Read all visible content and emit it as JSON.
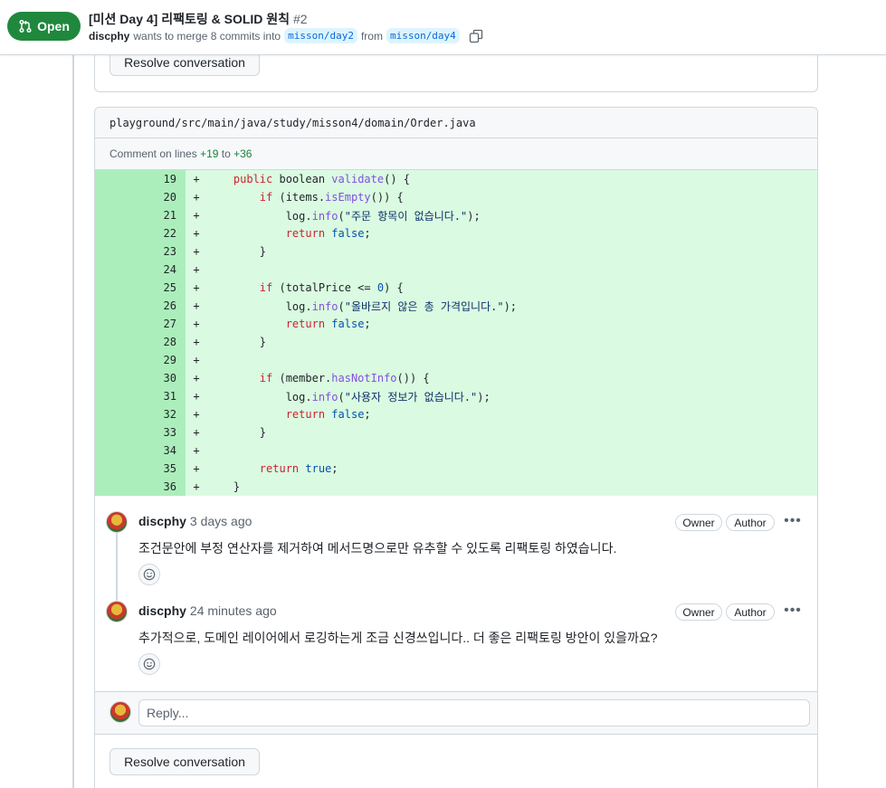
{
  "header": {
    "state_label": "Open",
    "title": "[미션 Day 4] 리팩토링 & SOLID 원칙",
    "number": "#2",
    "author": "discphy",
    "merge_text": "wants to merge 8 commits into",
    "base_branch": "misson/day2",
    "from_text": "from",
    "head_branch": "misson/day4"
  },
  "top_box": {
    "resolve_label": "Resolve conversation"
  },
  "thread": {
    "file_path": "playground/src/main/java/study/misson4/domain/Order.java",
    "comment_on_prefix": "Comment on lines",
    "line_start": "+19",
    "to_text": "to",
    "line_end": "+36",
    "diff": [
      {
        "n": "19",
        "m": "+",
        "tokens": [
          {
            "t": "    "
          },
          {
            "t": "public",
            "c": "kw"
          },
          {
            "t": " boolean "
          },
          {
            "t": "validate",
            "c": "fn"
          },
          {
            "t": "() {"
          }
        ]
      },
      {
        "n": "20",
        "m": "+",
        "tokens": [
          {
            "t": "        "
          },
          {
            "t": "if",
            "c": "kw"
          },
          {
            "t": " (items."
          },
          {
            "t": "isEmpty",
            "c": "fn"
          },
          {
            "t": "()) {"
          }
        ]
      },
      {
        "n": "21",
        "m": "+",
        "tokens": [
          {
            "t": "            log."
          },
          {
            "t": "info",
            "c": "fn"
          },
          {
            "t": "("
          },
          {
            "t": "\"주문 항목이 없습니다.\"",
            "c": "str"
          },
          {
            "t": ");"
          }
        ]
      },
      {
        "n": "22",
        "m": "+",
        "tokens": [
          {
            "t": "            "
          },
          {
            "t": "return",
            "c": "kw"
          },
          {
            "t": " "
          },
          {
            "t": "false",
            "c": "num"
          },
          {
            "t": ";"
          }
        ]
      },
      {
        "n": "23",
        "m": "+",
        "tokens": [
          {
            "t": "        }"
          }
        ]
      },
      {
        "n": "24",
        "m": "+",
        "tokens": [
          {
            "t": ""
          }
        ]
      },
      {
        "n": "25",
        "m": "+",
        "tokens": [
          {
            "t": "        "
          },
          {
            "t": "if",
            "c": "kw"
          },
          {
            "t": " (totalPrice <= "
          },
          {
            "t": "0",
            "c": "num"
          },
          {
            "t": ") {"
          }
        ]
      },
      {
        "n": "26",
        "m": "+",
        "tokens": [
          {
            "t": "            log."
          },
          {
            "t": "info",
            "c": "fn"
          },
          {
            "t": "("
          },
          {
            "t": "\"올바르지 않은 총 가격입니다.\"",
            "c": "str"
          },
          {
            "t": ");"
          }
        ]
      },
      {
        "n": "27",
        "m": "+",
        "tokens": [
          {
            "t": "            "
          },
          {
            "t": "return",
            "c": "kw"
          },
          {
            "t": " "
          },
          {
            "t": "false",
            "c": "num"
          },
          {
            "t": ";"
          }
        ]
      },
      {
        "n": "28",
        "m": "+",
        "tokens": [
          {
            "t": "        }"
          }
        ]
      },
      {
        "n": "29",
        "m": "+",
        "tokens": [
          {
            "t": ""
          }
        ]
      },
      {
        "n": "30",
        "m": "+",
        "tokens": [
          {
            "t": "        "
          },
          {
            "t": "if",
            "c": "kw"
          },
          {
            "t": " (member."
          },
          {
            "t": "hasNotInfo",
            "c": "fn"
          },
          {
            "t": "()) {"
          }
        ]
      },
      {
        "n": "31",
        "m": "+",
        "tokens": [
          {
            "t": "            log."
          },
          {
            "t": "info",
            "c": "fn"
          },
          {
            "t": "("
          },
          {
            "t": "\"사용자 정보가 없습니다.\"",
            "c": "str"
          },
          {
            "t": ");"
          }
        ]
      },
      {
        "n": "32",
        "m": "+",
        "tokens": [
          {
            "t": "            "
          },
          {
            "t": "return",
            "c": "kw"
          },
          {
            "t": " "
          },
          {
            "t": "false",
            "c": "num"
          },
          {
            "t": ";"
          }
        ]
      },
      {
        "n": "33",
        "m": "+",
        "tokens": [
          {
            "t": "        }"
          }
        ]
      },
      {
        "n": "34",
        "m": "+",
        "tokens": [
          {
            "t": ""
          }
        ]
      },
      {
        "n": "35",
        "m": "+",
        "tokens": [
          {
            "t": "        "
          },
          {
            "t": "return",
            "c": "kw"
          },
          {
            "t": " "
          },
          {
            "t": "true",
            "c": "num"
          },
          {
            "t": ";"
          }
        ]
      },
      {
        "n": "36",
        "m": "+",
        "tokens": [
          {
            "t": "    }"
          }
        ]
      }
    ],
    "comments": [
      {
        "author": "discphy",
        "time": "3 days ago",
        "badges": [
          "Owner",
          "Author"
        ],
        "body": "조건문안에 부정 연산자를 제거하여 메서드명으로만 유추할 수 있도록 리팩토링 하였습니다."
      },
      {
        "author": "discphy",
        "time": "24 minutes ago",
        "badges": [
          "Owner",
          "Author"
        ],
        "body": "추가적으로, 도메인 레이어에서 로깅하는게 조금 신경쓰입니다.. 더 좋은 리팩토링 방안이 있을까요?"
      }
    ],
    "reply_placeholder": "Reply...",
    "resolve_label": "Resolve conversation"
  }
}
